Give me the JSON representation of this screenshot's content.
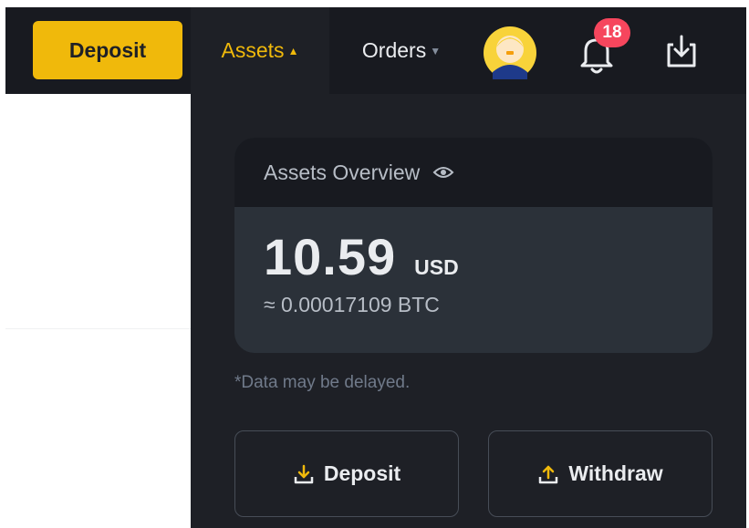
{
  "topbar": {
    "deposit_label": "Deposit",
    "assets_label": "Assets",
    "orders_label": "Orders",
    "notification_count": "18",
    "accent_color": "#f0b90b",
    "badge_color": "#f6465d"
  },
  "icons": {
    "assets_caret": "caret-up-icon",
    "orders_caret": "caret-down-icon",
    "avatar": "user-avatar",
    "notifications": "bell-icon",
    "download": "download-icon",
    "visibility": "eye-icon",
    "deposit": "deposit-icon",
    "withdraw": "withdraw-icon"
  },
  "assets_dropdown": {
    "overview_title": "Assets Overview",
    "balance_value": "10.59",
    "balance_unit": "USD",
    "btc_equivalent": "≈ 0.00017109 BTC",
    "delay_note": "*Data may be delayed.",
    "deposit_label": "Deposit",
    "withdraw_label": "Withdraw"
  }
}
